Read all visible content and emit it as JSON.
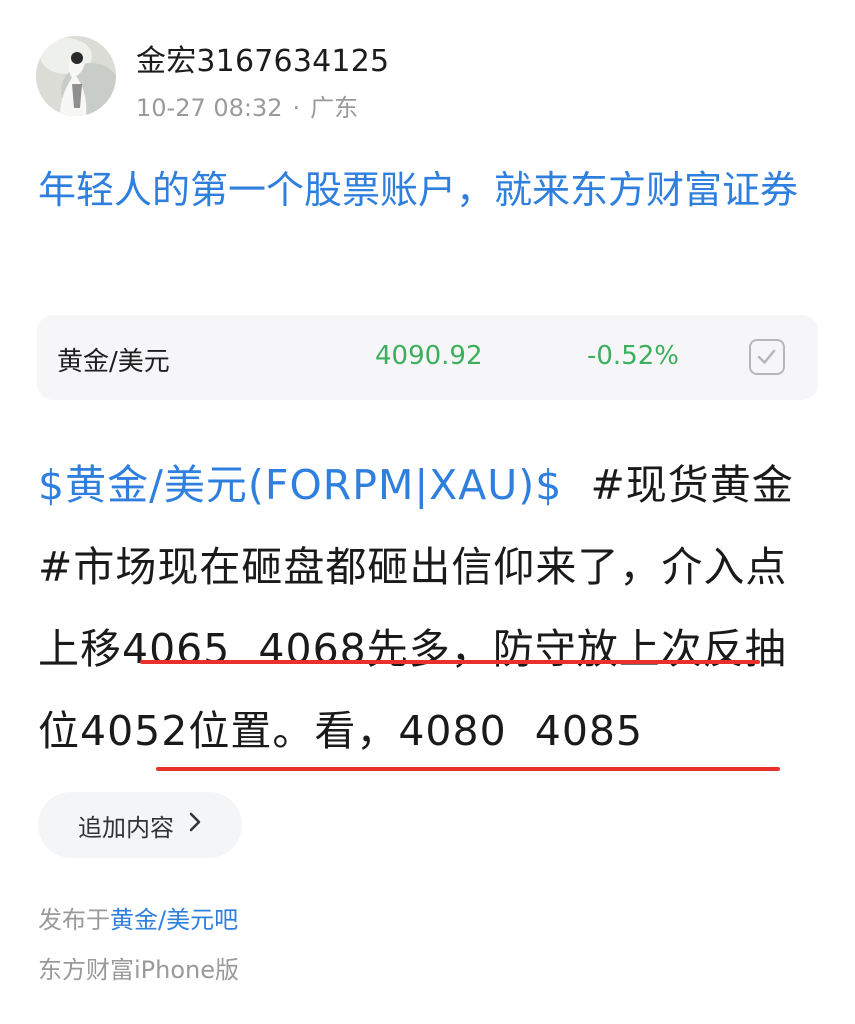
{
  "author": {
    "name": "金宏3167634125",
    "time": "10-27 08:32",
    "separator": "·",
    "location": "广东"
  },
  "promo": {
    "text": "年轻人的第一个股票账户，就来东方财富证券"
  },
  "quote": {
    "name": "黄金/美元",
    "price": "4090.92",
    "change": "-0.52%",
    "icon": "checkbox-icon"
  },
  "post": {
    "tag": "$黄金/美元(FORPM|XAU)$",
    "text": "  #现货黄金#市场现在砸盘都砸出信仰来了，介入点上移4065  4068先多，防守放上次反抽位4052位置。看，4080  4085"
  },
  "actions": {
    "add_content": "追加内容",
    "add_content_icon": "chevron-right-icon"
  },
  "footer": {
    "posted_prefix": "发布于",
    "bar_name": "黄金/美元吧",
    "device": "东方财富iPhone版"
  },
  "colors": {
    "accent": "#2f7fde",
    "quote_green": "#3cae5c",
    "underline_red": "#e8312a"
  }
}
